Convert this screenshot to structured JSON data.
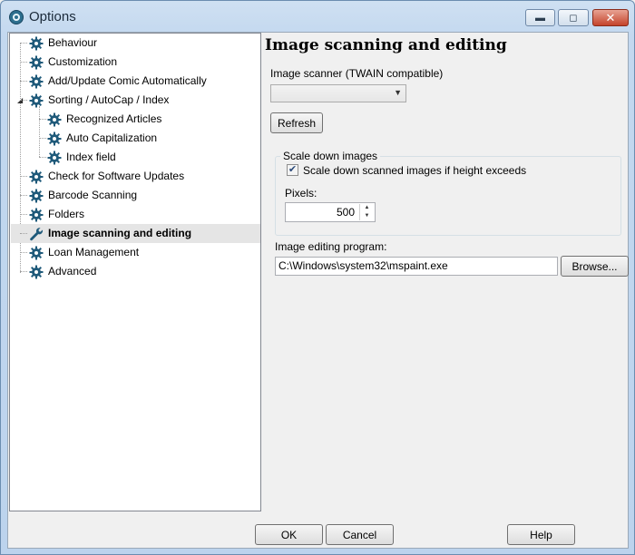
{
  "window": {
    "title": "Options",
    "caption_buttons": [
      "minimize",
      "maximize",
      "close"
    ]
  },
  "tree": {
    "items": [
      {
        "label": "Behaviour",
        "icon": "gear-icon",
        "level": 0
      },
      {
        "label": "Customization",
        "icon": "gear-icon",
        "level": 0
      },
      {
        "label": "Add/Update Comic Automatically",
        "icon": "gear-icon",
        "level": 0
      },
      {
        "label": "Sorting / AutoCap / Index",
        "icon": "gear-icon",
        "level": 0,
        "expanded": true
      },
      {
        "label": "Recognized Articles",
        "icon": "gear-icon",
        "level": 1
      },
      {
        "label": "Auto Capitalization",
        "icon": "gear-icon",
        "level": 1
      },
      {
        "label": "Index field",
        "icon": "gear-icon",
        "level": 1
      },
      {
        "label": "Check for Software Updates",
        "icon": "gear-icon",
        "level": 0
      },
      {
        "label": "Barcode Scanning",
        "icon": "gear-icon",
        "level": 0
      },
      {
        "label": "Folders",
        "icon": "gear-icon",
        "level": 0
      },
      {
        "label": "Image scanning and editing",
        "icon": "wrench-icon",
        "level": 0,
        "selected": true
      },
      {
        "label": "Loan Management",
        "icon": "gear-icon",
        "level": 0
      },
      {
        "label": "Advanced",
        "icon": "gear-icon",
        "level": 0
      }
    ]
  },
  "panel": {
    "title": "Image scanning and editing",
    "scanner_label": "Image scanner (TWAIN compatible)",
    "scanner_value": "",
    "refresh_label": "Refresh",
    "scale_group_title": "Scale down images",
    "scale_checkbox_label": "Scale down scanned images if height exceeds",
    "scale_checked": true,
    "pixels_label": "Pixels:",
    "pixels_value": "500",
    "editing_label": "Image editing program:",
    "editing_value": "C:\\Windows\\system32\\mspaint.exe",
    "browse_label": "Browse..."
  },
  "footer": {
    "ok_label": "OK",
    "cancel_label": "Cancel",
    "help_label": "Help"
  },
  "colors": {
    "titlebar": "#c3d8ef",
    "gear_icon": "#1f5a7a",
    "selected_row": "#e5e5e5"
  }
}
